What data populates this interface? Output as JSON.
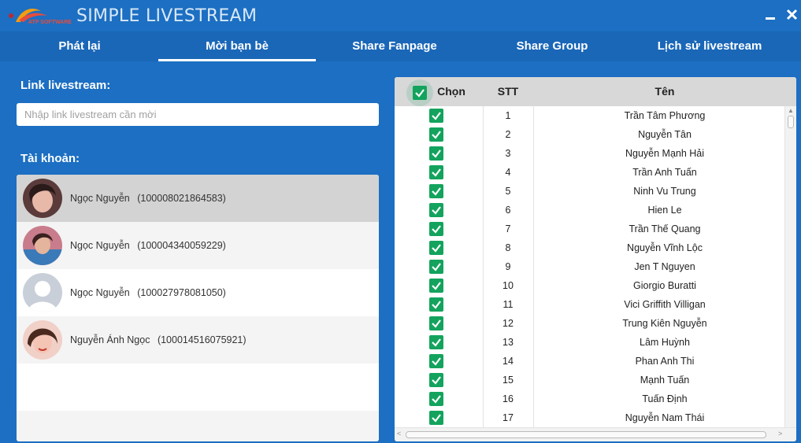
{
  "app": {
    "title": "SIMPLE LIVESTREAM",
    "logo_text": "ATP SOFTWARE"
  },
  "tabs": [
    {
      "label": "Phát lại",
      "active": false
    },
    {
      "label": "Mời bạn bè",
      "active": true
    },
    {
      "label": "Share Fanpage",
      "active": false
    },
    {
      "label": "Share Group",
      "active": false
    },
    {
      "label": "Lịch sử livestream",
      "active": false
    }
  ],
  "left": {
    "link_label": "Link livestream:",
    "link_placeholder": "Nhập link livestream cần mời",
    "link_value": "",
    "accounts_label": "Tài khoản:",
    "accounts": [
      {
        "name": "Ngọc Nguyễn",
        "id": "(100008021864583)",
        "selected": true
      },
      {
        "name": "Ngọc Nguyễn",
        "id": "(100004340059229)",
        "selected": false
      },
      {
        "name": "Ngọc Nguyễn",
        "id": "(100027978081050)",
        "selected": false
      },
      {
        "name": "Nguyễn Ánh Ngọc",
        "id": "(100014516075921)",
        "selected": false
      }
    ]
  },
  "table": {
    "headers": {
      "choose": "Chọn",
      "stt": "STT",
      "name": "Tên"
    },
    "select_all": true,
    "rows": [
      {
        "stt": "1",
        "name": "Trần Tâm Phương",
        "checked": true
      },
      {
        "stt": "2",
        "name": "Nguyễn Tân",
        "checked": true
      },
      {
        "stt": "3",
        "name": "Nguyễn Mạnh Hải",
        "checked": true
      },
      {
        "stt": "4",
        "name": "Trần Anh Tuấn",
        "checked": true
      },
      {
        "stt": "5",
        "name": "Ninh Vu Trung",
        "checked": true
      },
      {
        "stt": "6",
        "name": "Hien Le",
        "checked": true
      },
      {
        "stt": "7",
        "name": "Trần Thế Quang",
        "checked": true
      },
      {
        "stt": "8",
        "name": "Nguyễn Vĩnh Lộc",
        "checked": true
      },
      {
        "stt": "9",
        "name": "Jen T Nguyen",
        "checked": true
      },
      {
        "stt": "10",
        "name": "Giorgio Buratti",
        "checked": true
      },
      {
        "stt": "11",
        "name": "Vici Griffith Villigan",
        "checked": true
      },
      {
        "stt": "12",
        "name": "Trung Kiên Nguyễn",
        "checked": true
      },
      {
        "stt": "13",
        "name": "Lâm Huỳnh",
        "checked": true
      },
      {
        "stt": "14",
        "name": "Phan Anh Thi",
        "checked": true
      },
      {
        "stt": "15",
        "name": "Mạnh Tuấn",
        "checked": true
      },
      {
        "stt": "16",
        "name": "Tuấn Định",
        "checked": true
      },
      {
        "stt": "17",
        "name": "Nguyễn Nam Thái",
        "checked": true
      }
    ]
  },
  "colors": {
    "primary": "#1c6fc2",
    "tab_bar": "#1a67b8",
    "check_green": "#13a35d",
    "header_gray": "#d8d8d8"
  }
}
